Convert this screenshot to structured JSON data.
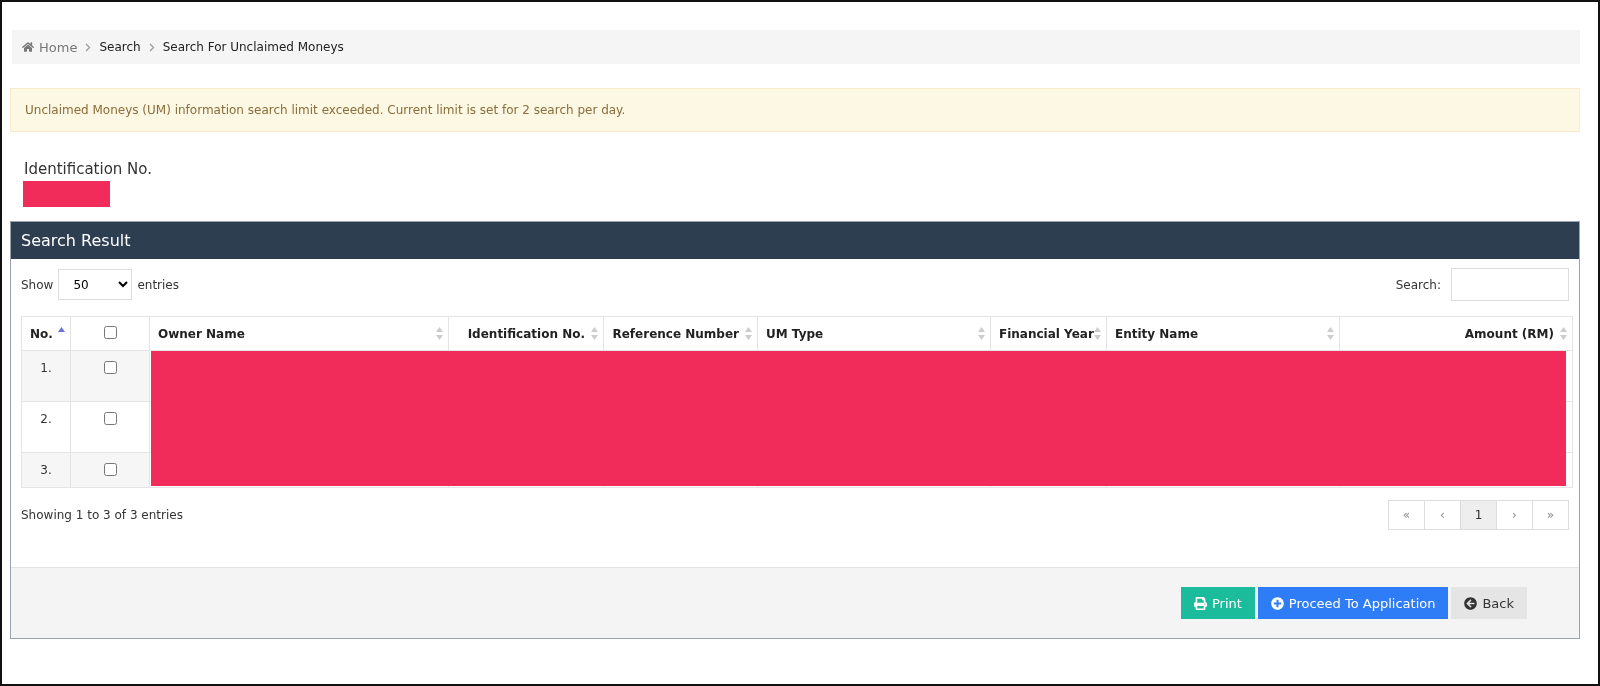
{
  "breadcrumb": [
    {
      "label": "Home",
      "kind": "home"
    },
    {
      "label": "Search",
      "kind": "link"
    },
    {
      "label": "Search For Unclaimed Moneys",
      "kind": "link"
    }
  ],
  "alert": "Unclaimed Moneys (UM) information search limit exceeded. Current limit is set for 2 search per day.",
  "identification": {
    "label": "Identification No.",
    "redacted": true
  },
  "panel": {
    "title": "Search Result",
    "length": {
      "show": "Show",
      "value": "50",
      "entries": "entries"
    },
    "search": {
      "label": "Search:"
    },
    "table": {
      "columns": [
        {
          "label": "No.",
          "kind": "text",
          "sorted": true
        },
        {
          "kind": "checkbox",
          "checked": false
        },
        {
          "label": "Owner Name",
          "kind": "text",
          "sorted": false
        },
        {
          "label": "Identification No.",
          "kind": "text",
          "sorted": false
        },
        {
          "label": "Reference Number",
          "kind": "text",
          "sorted": false
        },
        {
          "label": "UM Type",
          "kind": "text",
          "sorted": false
        },
        {
          "label": "Financial Year",
          "kind": "text",
          "sorted": false
        },
        {
          "label": "Entity Name",
          "kind": "text",
          "sorted": false
        },
        {
          "label": "Amount (RM)",
          "kind": "text",
          "sorted": false
        }
      ],
      "rows": [
        {
          "no": "1.",
          "checked": false
        },
        {
          "no": "2.",
          "checked": false
        },
        {
          "no": "3.",
          "checked": false
        }
      ],
      "redacted": true
    },
    "info": "Showing 1 to 3 of 3 entries",
    "pagination": [
      {
        "label": "«",
        "selected": false
      },
      {
        "label": "‹",
        "selected": false
      },
      {
        "label": "1",
        "selected": true
      },
      {
        "label": "›",
        "selected": false
      },
      {
        "label": "»",
        "selected": false
      }
    ],
    "buttons": [
      {
        "label": "Print",
        "kind": "print"
      },
      {
        "label": "Proceed To Application",
        "kind": "proceed"
      },
      {
        "label": "Back",
        "kind": "back"
      }
    ]
  }
}
